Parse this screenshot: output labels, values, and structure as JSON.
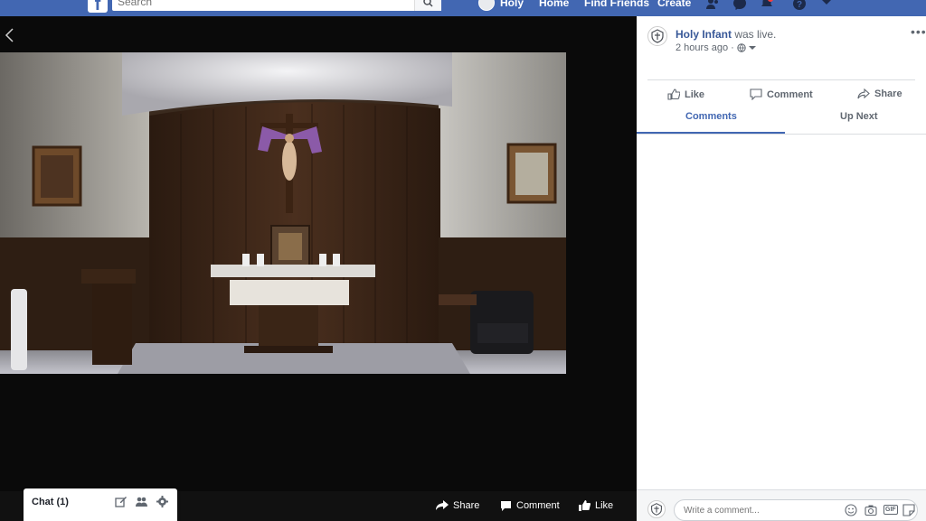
{
  "topbar": {
    "logo": "f",
    "search_placeholder": "Search",
    "profile_name": "Holy",
    "nav_home": "Home",
    "nav_find_friends": "Find Friends",
    "nav_create": "Create",
    "brand_color": "#4267b2"
  },
  "video_bar": {
    "share": "Share",
    "comment": "Comment",
    "like": "Like"
  },
  "chat": {
    "label": "Chat (1)"
  },
  "post": {
    "author": "Holy Infant",
    "status": "was live.",
    "time": "2 hours ago ·",
    "more": "•••",
    "actions": {
      "like": "Like",
      "comment": "Comment",
      "share": "Share"
    },
    "tabs": {
      "comments": "Comments",
      "up_next": "Up Next"
    }
  },
  "comment_box": {
    "placeholder": "Write a comment...",
    "gif": "GIF"
  }
}
